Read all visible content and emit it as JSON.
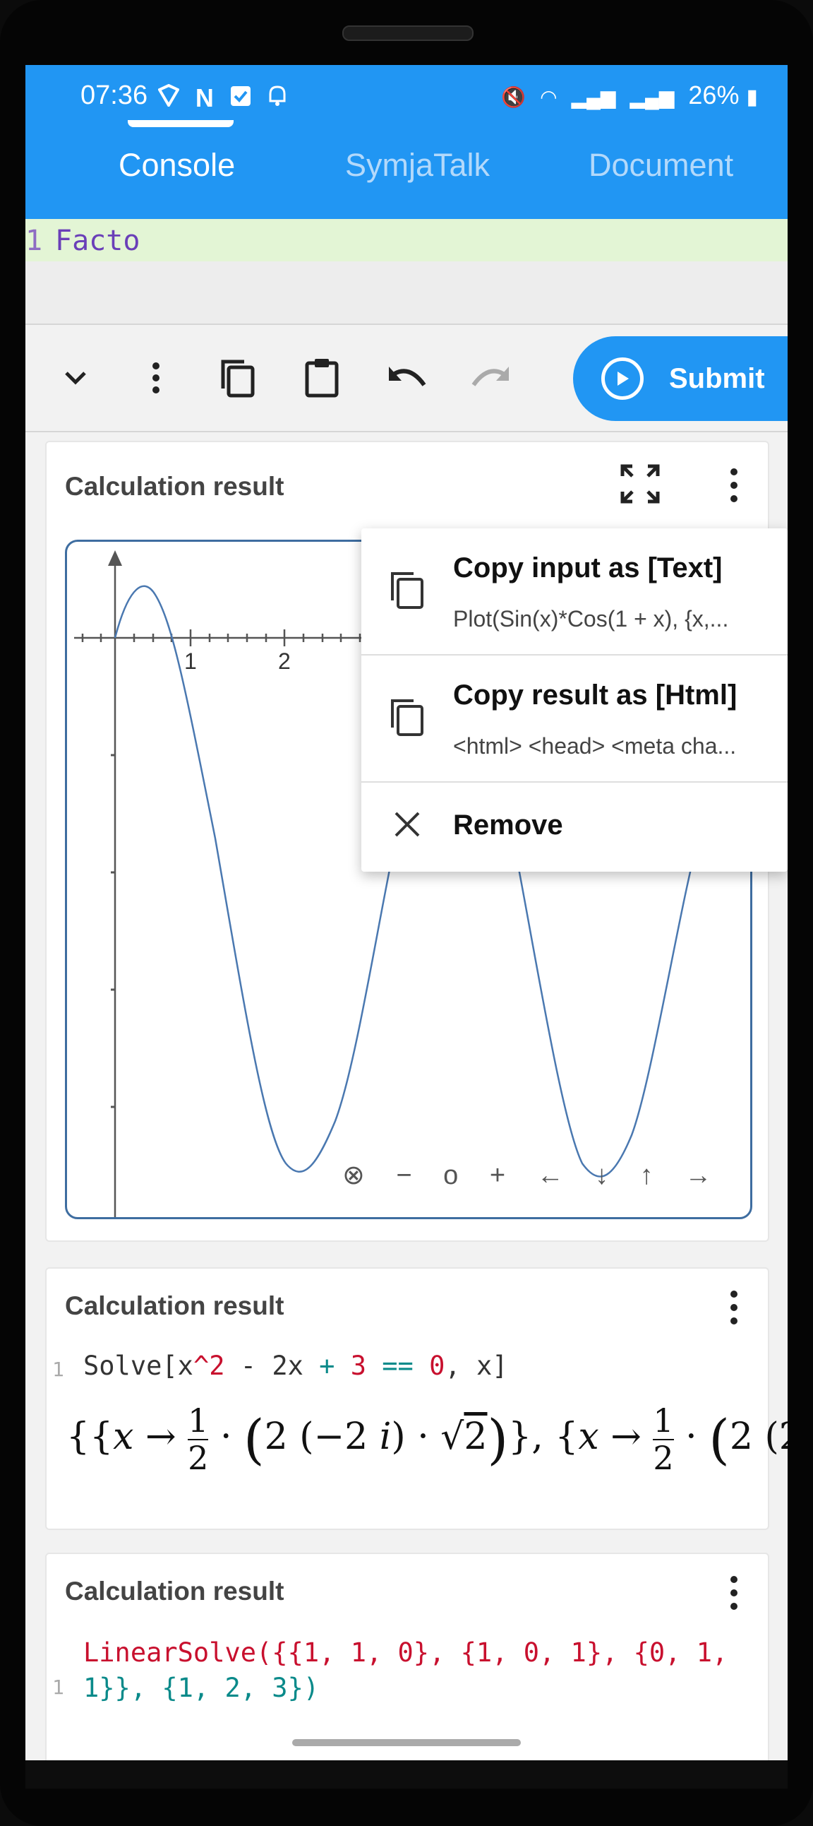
{
  "status": {
    "time": "07:36",
    "battery": "26%"
  },
  "tabs": [
    {
      "label": "Console"
    },
    {
      "label": "SymjaTalk"
    },
    {
      "label": "Document"
    }
  ],
  "editor": {
    "line_number": "1",
    "text": "Facto"
  },
  "toolbar": {
    "submit_label": "Submit"
  },
  "cards": [
    {
      "title": "Calculation result",
      "graph": {
        "tick_labels": [
          "1",
          "2"
        ],
        "nav_controls": [
          "⊗",
          "−",
          "o",
          "+",
          "←",
          "↓",
          "↑",
          "→"
        ]
      }
    },
    {
      "title": "Calculation result",
      "line_number": "1",
      "input": "Solve[x^2 - 2x + 3 == 0, x]"
    },
    {
      "title": "Calculation result",
      "line_number": "1",
      "input_line1": "LinearSolve({{1, 1, 0}, {1, 0, 1}, {0, 1,",
      "input_line2": "1}}, {1, 2, 3})"
    }
  ],
  "menu": {
    "items": [
      {
        "title": "Copy input as [Text]",
        "subtitle": "Plot(Sin(x)*Cos(1 + x), {x,..."
      },
      {
        "title": "Copy result as [Html]",
        "subtitle": "<html> <head> <meta cha..."
      },
      {
        "title": "Remove"
      }
    ]
  },
  "colors": {
    "accent": "#2196f3",
    "editor_line_bg": "#e3f5d5",
    "code_red": "#c8102e",
    "code_teal": "#0a8a8a",
    "graph_line": "#4a78b0"
  }
}
